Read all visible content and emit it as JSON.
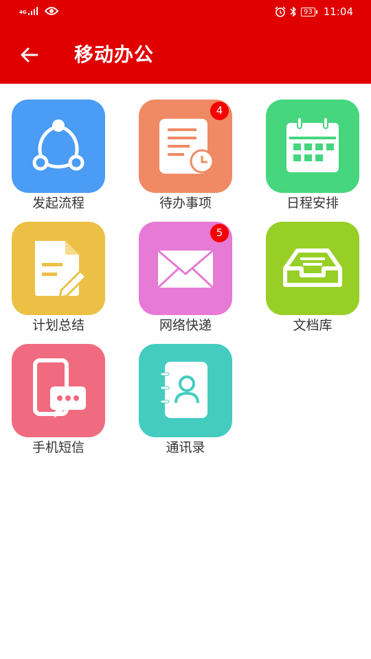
{
  "status_bar": {
    "network": "4G",
    "battery": "93",
    "time": "11:04"
  },
  "header": {
    "title": "移动办公"
  },
  "apps": [
    {
      "label": "发起流程",
      "icon": "share-circle-icon",
      "color": "#4a9cf5",
      "badge": ""
    },
    {
      "label": "待办事项",
      "icon": "todo-document-clock-icon",
      "color": "#f08a64",
      "badge": "4"
    },
    {
      "label": "日程安排",
      "icon": "calendar-icon",
      "color": "#45d67e",
      "badge": ""
    },
    {
      "label": "计划总结",
      "icon": "document-edit-icon",
      "color": "#ebc045",
      "badge": ""
    },
    {
      "label": "网络快递",
      "icon": "envelope-icon",
      "color": "#e67ad4",
      "badge": "5"
    },
    {
      "label": "文档库",
      "icon": "document-tray-icon",
      "color": "#97cf27",
      "badge": ""
    },
    {
      "label": "手机短信",
      "icon": "phone-message-icon",
      "color": "#f06b80",
      "badge": ""
    },
    {
      "label": "通讯录",
      "icon": "address-book-icon",
      "color": "#44ccc0",
      "badge": ""
    }
  ]
}
